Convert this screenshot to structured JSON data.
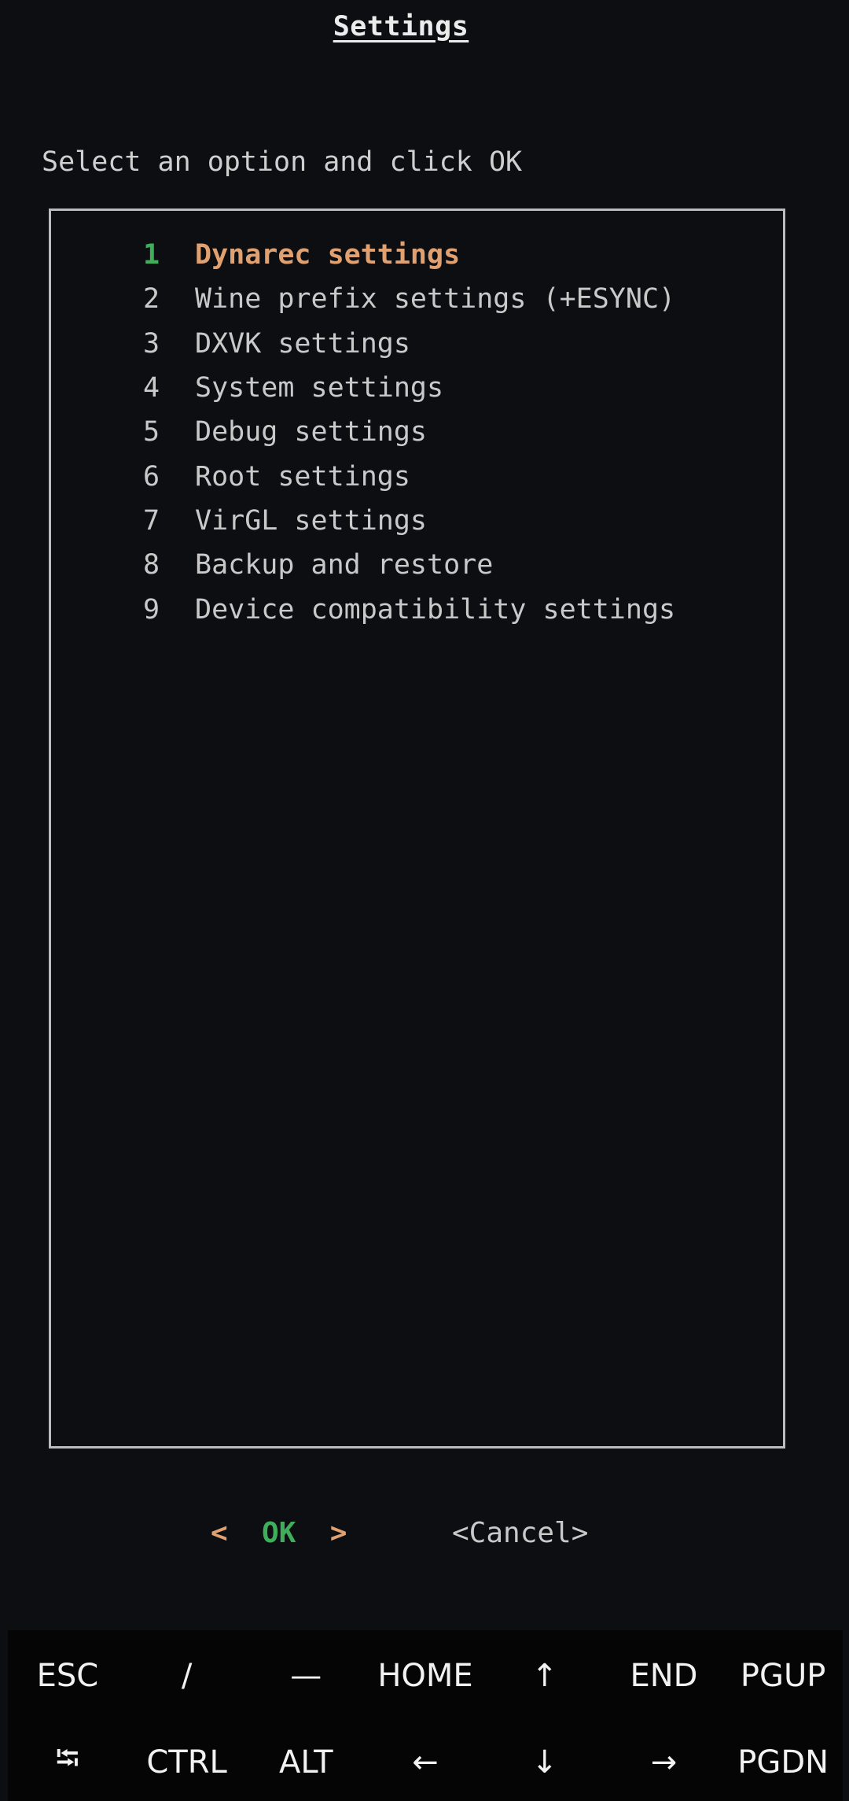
{
  "dialog": {
    "title": "Settings",
    "prompt": "Select an option and click OK",
    "menu_items": [
      {
        "num": "1",
        "label": "Dynarec settings",
        "selected": true
      },
      {
        "num": "2",
        "label": "Wine prefix settings (+ESYNC)",
        "selected": false
      },
      {
        "num": "3",
        "label": "DXVK settings",
        "selected": false
      },
      {
        "num": "4",
        "label": "System settings",
        "selected": false
      },
      {
        "num": "5",
        "label": "Debug settings",
        "selected": false
      },
      {
        "num": "6",
        "label": "Root settings",
        "selected": false
      },
      {
        "num": "7",
        "label": "VirGL settings",
        "selected": false
      },
      {
        "num": "8",
        "label": "Backup and restore",
        "selected": false
      },
      {
        "num": "9",
        "label": "Device compatibility settings",
        "selected": false
      }
    ],
    "ok_button": {
      "left_bracket": "<",
      "label": "OK",
      "right_bracket": ">"
    },
    "cancel_button": "<Cancel>"
  },
  "extra_keys": {
    "row1": [
      {
        "label": "ESC",
        "icon": "esc-key"
      },
      {
        "label": "/",
        "icon": "slash-key"
      },
      {
        "label": "—",
        "icon": "dash-key"
      },
      {
        "label": "HOME",
        "icon": "home-key"
      },
      {
        "label": "↑",
        "icon": "arrow-up-icon"
      },
      {
        "label": "END",
        "icon": "end-key"
      },
      {
        "label": "PGUP",
        "icon": "pgup-key"
      }
    ],
    "row2": [
      {
        "label": "⭾",
        "icon": "tab-icon"
      },
      {
        "label": "CTRL",
        "icon": "ctrl-key"
      },
      {
        "label": "ALT",
        "icon": "alt-key"
      },
      {
        "label": "←",
        "icon": "arrow-left-icon"
      },
      {
        "label": "↓",
        "icon": "arrow-down-icon"
      },
      {
        "label": "→",
        "icon": "arrow-right-icon"
      },
      {
        "label": "PGDN",
        "icon": "pgdn-key"
      }
    ]
  },
  "colors": {
    "background": "#0d0e11",
    "text": "#c9c9c9",
    "highlight_label": "#e0a070",
    "highlight_number": "#3fae5a",
    "border": "#bcbcbc",
    "key_bar": "#050505"
  }
}
